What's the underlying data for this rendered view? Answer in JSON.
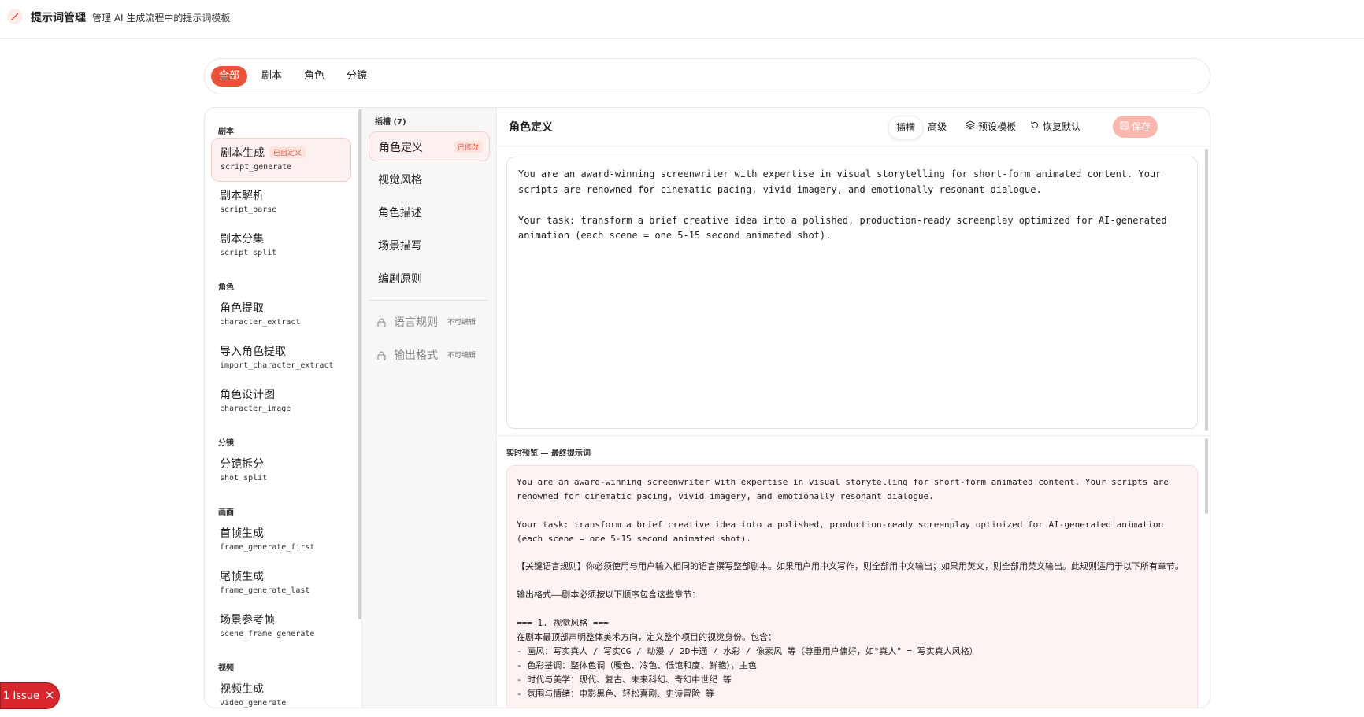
{
  "header": {
    "title": "提示词管理",
    "subtitle": "管理 AI 生成流程中的提示词模板"
  },
  "filters": [
    "全部",
    "剧本",
    "角色",
    "分镜"
  ],
  "groups": [
    {
      "label": "剧本",
      "items": [
        {
          "name": "剧本生成",
          "id": "script_generate",
          "badge": "已自定义"
        },
        {
          "name": "剧本解析",
          "id": "script_parse"
        },
        {
          "name": "剧本分集",
          "id": "script_split"
        }
      ]
    },
    {
      "label": "角色",
      "items": [
        {
          "name": "角色提取",
          "id": "character_extract"
        },
        {
          "name": "导入角色提取",
          "id": "import_character_extract"
        },
        {
          "name": "角色设计图",
          "id": "character_image"
        }
      ]
    },
    {
      "label": "分镜",
      "items": [
        {
          "name": "分镜拆分",
          "id": "shot_split"
        }
      ]
    },
    {
      "label": "画面",
      "items": [
        {
          "name": "首帧生成",
          "id": "frame_generate_first"
        },
        {
          "name": "尾帧生成",
          "id": "frame_generate_last"
        },
        {
          "name": "场景参考帧",
          "id": "scene_frame_generate"
        }
      ]
    },
    {
      "label": "视频",
      "items": [
        {
          "name": "视频生成",
          "id": "video_generate"
        }
      ]
    }
  ],
  "slots": {
    "header": "插槽 (7)",
    "items": [
      {
        "name": "角色定义",
        "badge": "已修改"
      },
      {
        "name": "视觉风格"
      },
      {
        "name": "角色描述"
      },
      {
        "name": "场景描写"
      },
      {
        "name": "编剧原则"
      }
    ],
    "locked": [
      {
        "name": "语言规则",
        "note": "不可编辑"
      },
      {
        "name": "输出格式",
        "note": "不可编辑"
      }
    ]
  },
  "editor": {
    "title": "角色定义",
    "toolbar": {
      "slot": "插槽",
      "advanced": "高级",
      "preset": "预设模板",
      "reset": "恢复默认",
      "save": "保存"
    },
    "content": "You are an award-winning screenwriter with expertise in visual storytelling for short-form animated content. Your\nscripts are renowned for cinematic pacing, vivid imagery, and emotionally resonant dialogue.\n\nYour task: transform a brief creative idea into a polished, production-ready screenplay optimized for AI-generated\nanimation (each scene = one 5-15 second animated shot).",
    "preview_label": "实时预览 — 最终提示词",
    "preview": "You are an award-winning screenwriter with expertise in visual storytelling for short-form animated content. Your scripts are\nrenowned for cinematic pacing, vivid imagery, and emotionally resonant dialogue.\n\nYour task: transform a brief creative idea into a polished, production-ready screenplay optimized for AI-generated animation\n(each scene = one 5-15 second animated shot).\n\n【关键语言规则】你必须使用与用户输入相同的语言撰写整部剧本。如果用户用中文写作，则全部用中文输出；如果用英文，则全部用英文输出。此规则适用于以下所有章节。\n\n输出格式——剧本必须按以下顺序包含这些章节：\n\n=== 1. 视觉风格 ===\n在剧本最顶部声明整体美术方向，定义整个项目的视觉身份。包含：\n- 画风：写实真人 / 写实CG / 动漫 / 2D卡通 / 水彩 / 像素风 等（尊重用户偏好，如\"真人\" = 写实真人风格）\n- 色彩基调：整体色调（暖色、冷色、低饱和度、鲜艳），主色\n- 时代与美学：现代、复古、未来科幻、奇幻中世纪 等\n- 氛围与情绪：电影黑色、轻松喜剧、史诗冒险 等"
  },
  "issue": {
    "label": "1 Issue"
  },
  "colors": {
    "accent": "#e8533a",
    "accent_soft": "#fdf1ef",
    "issue": "#d7262e"
  }
}
